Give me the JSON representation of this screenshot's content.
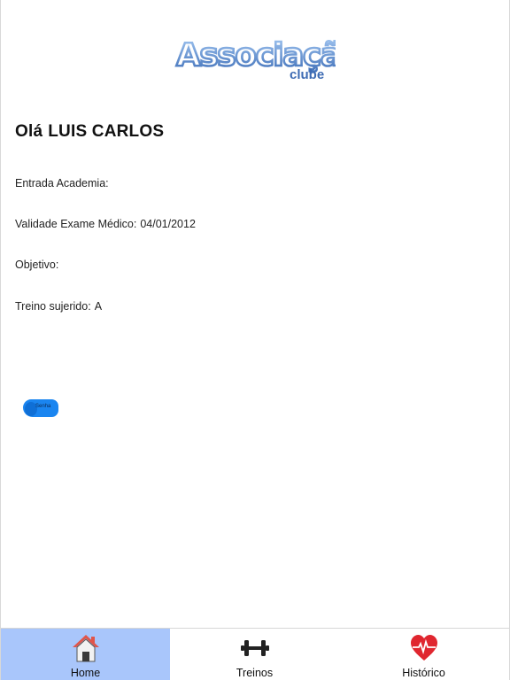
{
  "header": {
    "logo_main": "Associação",
    "logo_sub": "clube"
  },
  "greeting": {
    "prefix": "Olá",
    "name": "LUIS CARLOS"
  },
  "info": {
    "entrada_label": "Entrada Academia:",
    "entrada_value": "",
    "validade_label": "Validade Exame Médico:",
    "validade_value": "04/01/2012",
    "objetivo_label": "Objetivo:",
    "objetivo_value": "",
    "treino_label": "Treino sujerido:",
    "treino_value": "A"
  },
  "senha_button": {
    "label": "Senha",
    "color": "#1a85f0"
  },
  "tabs": [
    {
      "label": "Home",
      "icon": "home-icon",
      "active": true
    },
    {
      "label": "Treinos",
      "icon": "dumbbell-icon",
      "active": false
    },
    {
      "label": "Histórico",
      "icon": "heartbeat-icon",
      "active": false
    }
  ],
  "colors": {
    "active_tab": "#a9c6fb",
    "logo_blue": "#4a7fc4",
    "heart_red": "#e0262f",
    "roof_red": "#e0554a"
  }
}
